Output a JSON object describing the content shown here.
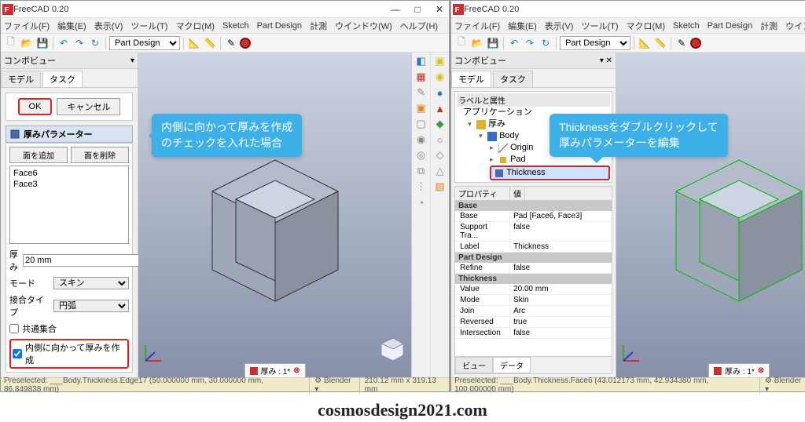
{
  "app": {
    "title": "FreeCAD 0.20"
  },
  "titlebar": {
    "min": "—",
    "max": "□",
    "close": "✕"
  },
  "menu": [
    "ファイル(F)",
    "編集(E)",
    "表示(V)",
    "ツール(T)",
    "マクロ(M)",
    "Sketch",
    "Part Design",
    "計測",
    "ウインドウ(W)",
    "ヘルプ(H)"
  ],
  "workbench": "Part Design",
  "combo": {
    "title": "コンボビュー",
    "tabs": {
      "model": "モデル",
      "task": "タスク"
    }
  },
  "task": {
    "ok": "OK",
    "cancel": "キャンセル",
    "header": "厚みパラメーター",
    "add_face": "面を追加",
    "del_face": "面を削除",
    "faces": [
      "Face6",
      "Face3"
    ],
    "thickness_label": "厚み",
    "thickness_val": "20 mm",
    "mode_label": "モード",
    "mode_val": "スキン",
    "join_label": "接合タイプ",
    "join_val": "円弧",
    "intersection_label": "共通集合",
    "inward_label": "内側に向かって厚みを作成"
  },
  "tree": {
    "labels_title": "ラベルと属性",
    "app_title": "アプリケーション",
    "doc": "厚み",
    "body": "Body",
    "origin": "Origin",
    "pad": "Pad",
    "thickness": "Thickness"
  },
  "props": {
    "hdr_prop": "プロパティ",
    "hdr_val": "値",
    "grp_base": "Base",
    "base_k": "Base",
    "base_v": "Pad [Face6, Face3]",
    "support_k": "Support Tra...",
    "support_v": "false",
    "label_k": "Label",
    "label_v": "Thickness",
    "grp_pd": "Part Design",
    "refine_k": "Refine",
    "refine_v": "false",
    "grp_th": "Thickness",
    "value_k": "Value",
    "value_v": "20.00 mm",
    "mode_k": "Mode",
    "mode_v": "Skin",
    "join_k": "Join",
    "join_v": "Arc",
    "rev_k": "Reversed",
    "rev_v": "true",
    "int_k": "Intersection",
    "int_v": "false",
    "tab_view": "ビュー",
    "tab_data": "データ"
  },
  "viewport": {
    "doc_tab": "厚み : 1*"
  },
  "status": {
    "left_pre": "Preselected: ___Body.Thickness.Edge17 (50.000000 mm, 30.000000 mm, 86.849838 mm)",
    "right_pre": "Preselected: ___Body.Thickness.Face6 (43.012173 mm, 42.934380 mm, 100.000000 mm)",
    "nav": "Blender",
    "dims": "210.12 mm x 319.13 mm"
  },
  "callouts": {
    "c1a": "内側に向かって厚みを作成",
    "c1b": "のチェックを入れた場合",
    "c2a": "Thicknessをダブルクリックして",
    "c2b": "厚みパラメーターを編集"
  },
  "watermark": "cosmosdesign2021.com"
}
